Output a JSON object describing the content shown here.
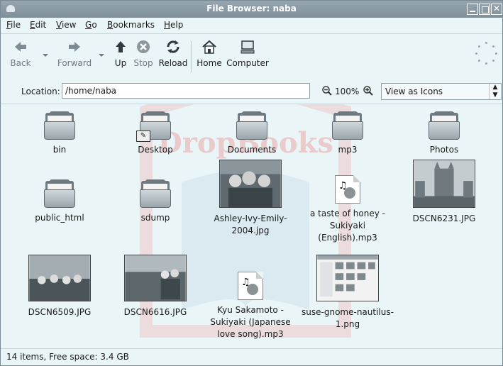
{
  "window": {
    "title": "File Browser: naba"
  },
  "menubar": [
    "File",
    "Edit",
    "View",
    "Go",
    "Bookmarks",
    "Help"
  ],
  "toolbar": {
    "back": "Back",
    "forward": "Forward",
    "up": "Up",
    "stop": "Stop",
    "reload": "Reload",
    "home": "Home",
    "computer": "Computer"
  },
  "location": {
    "label": "Location:",
    "path": "/home/naba",
    "zoom": "100%",
    "view_mode": "View as Icons"
  },
  "files": [
    {
      "name": "bin",
      "type": "folder"
    },
    {
      "name": "Desktop",
      "type": "folder"
    },
    {
      "name": "Documents",
      "type": "folder"
    },
    {
      "name": "mp3",
      "type": "folder"
    },
    {
      "name": "Photos",
      "type": "folder"
    },
    {
      "name": "public_html",
      "type": "folder"
    },
    {
      "name": "sdump",
      "type": "folder"
    },
    {
      "name": "Ashley-Ivy-Emily-2004.jpg",
      "type": "image"
    },
    {
      "name": "a taste of honey - Sukiyaki (English).mp3",
      "type": "audio"
    },
    {
      "name": "DSCN6231.JPG",
      "type": "image"
    },
    {
      "name": "DSCN6509.JPG",
      "type": "image"
    },
    {
      "name": "DSCN6616.JPG",
      "type": "image"
    },
    {
      "name": "Kyu Sakamoto - Sukiyaki (Japanese love song).mp3",
      "type": "audio"
    },
    {
      "name": "suse-gnome-nautilus-1.png",
      "type": "image"
    }
  ],
  "status": "14 items, Free space: 3.4 GB",
  "watermark": "DropBooks",
  "colors": {
    "titlebar": "#8a9aa4",
    "window_bg": "#eaf5f8",
    "watermark": "#e9a9a9"
  }
}
